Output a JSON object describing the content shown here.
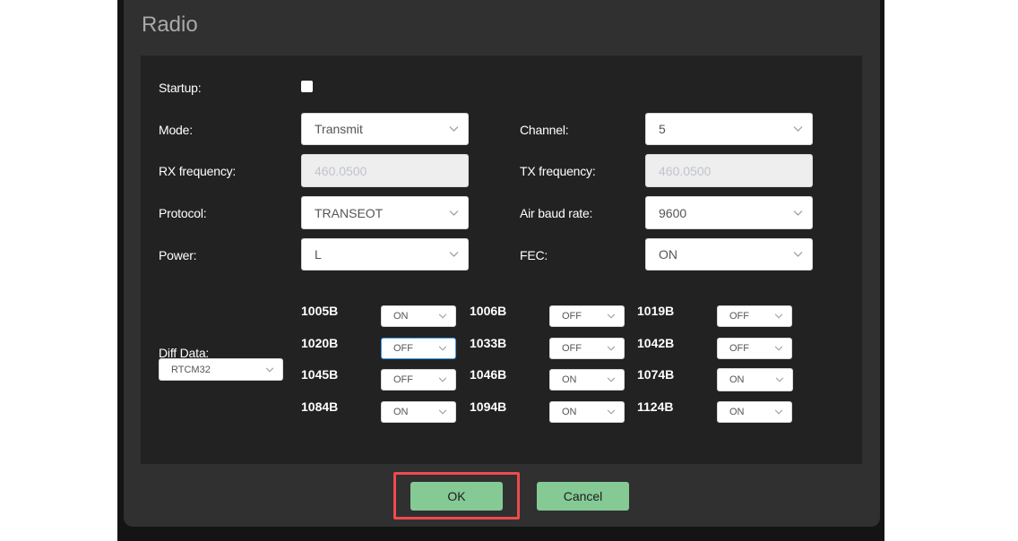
{
  "dialog": {
    "title": "Radio"
  },
  "startup": {
    "label": "Startup:"
  },
  "mode": {
    "label": "Mode:",
    "value": "Transmit"
  },
  "channel": {
    "label": "Channel:",
    "value": "5"
  },
  "rx_frequency": {
    "label": "RX frequency:",
    "value": "460.0500"
  },
  "tx_frequency": {
    "label": "TX frequency:",
    "value": "460.0500"
  },
  "protocol": {
    "label": "Protocol:",
    "value": "TRANSEOT"
  },
  "air_baud_rate": {
    "label": "Air baud rate:",
    "value": "9600"
  },
  "power": {
    "label": "Power:",
    "value": "L"
  },
  "fec": {
    "label": "FEC:",
    "value": "ON"
  },
  "diff_data": {
    "label": "Diff Data:",
    "value": "RTCM32",
    "messages": [
      {
        "code": "1005B",
        "value": "ON"
      },
      {
        "code": "1006B",
        "value": "OFF"
      },
      {
        "code": "1019B",
        "value": "OFF"
      },
      {
        "code": "1020B",
        "value": "OFF"
      },
      {
        "code": "1033B",
        "value": "OFF"
      },
      {
        "code": "1042B",
        "value": "OFF"
      },
      {
        "code": "1045B",
        "value": "OFF"
      },
      {
        "code": "1046B",
        "value": "ON"
      },
      {
        "code": "1074B",
        "value": "ON"
      },
      {
        "code": "1084B",
        "value": "ON"
      },
      {
        "code": "1094B",
        "value": "ON"
      },
      {
        "code": "1124B",
        "value": "ON"
      }
    ]
  },
  "buttons": {
    "ok": "OK",
    "cancel": "Cancel"
  },
  "colors": {
    "button": "#85c995",
    "highlight": "#ef4a4f",
    "panel": "#222222",
    "dialog": "#303030"
  }
}
